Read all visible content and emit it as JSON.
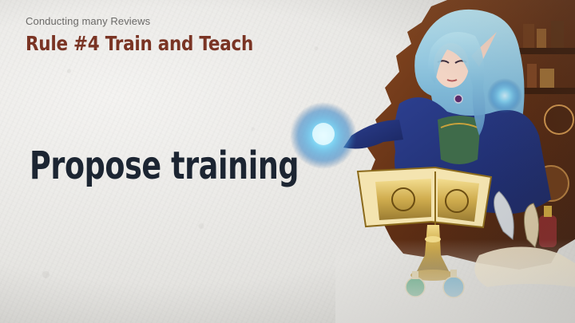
{
  "slide": {
    "subtitle": "Conducting many Reviews",
    "title": "Rule #4 Train and Teach",
    "body": "Propose training"
  },
  "colors": {
    "background": "#e9e8e5",
    "title": "#7a3424",
    "subtitle": "#6b6a68",
    "body": "#1c2532"
  },
  "illustration": {
    "description_icon": "elf-mage-reading-book-illustration"
  }
}
